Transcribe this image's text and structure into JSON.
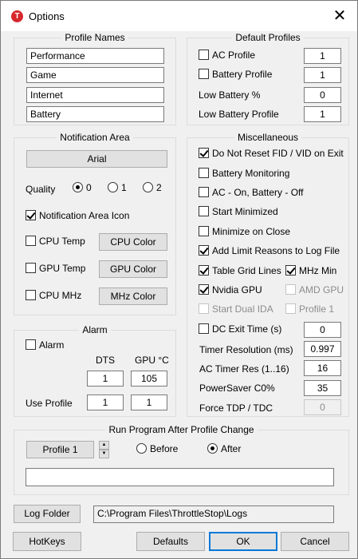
{
  "window": {
    "title": "Options",
    "icon_letter": "T",
    "close_glyph": "✕"
  },
  "profile_names": {
    "title": "Profile Names",
    "names": [
      "Performance",
      "Game",
      "Internet",
      "Battery"
    ]
  },
  "default_profiles": {
    "title": "Default Profiles",
    "rows": [
      {
        "label": "AC Profile",
        "value": "1",
        "checkbox": true,
        "checked": false
      },
      {
        "label": "Battery Profile",
        "value": "1",
        "checkbox": true,
        "checked": false
      },
      {
        "label": "Low Battery %",
        "value": "0",
        "checkbox": false
      },
      {
        "label": "Low Battery Profile",
        "value": "1",
        "checkbox": false
      }
    ]
  },
  "notification_area": {
    "title": "Notification Area",
    "font_button": "Arial",
    "quality_label": "Quality",
    "quality_options": [
      "0",
      "1",
      "2"
    ],
    "quality_selected": "0",
    "icon_label": "Notification Area Icon",
    "icon_checked": true,
    "items": [
      {
        "label": "CPU Temp",
        "checked": false,
        "button": "CPU Color"
      },
      {
        "label": "GPU Temp",
        "checked": false,
        "button": "GPU Color"
      },
      {
        "label": "CPU MHz",
        "checked": false,
        "button": "MHz Color"
      }
    ]
  },
  "miscellaneous": {
    "title": "Miscellaneous",
    "checks": [
      {
        "label": "Do Not Reset FID / VID on Exit",
        "checked": true
      },
      {
        "label": "Battery Monitoring",
        "checked": false
      },
      {
        "label": "AC - On, Battery - Off",
        "checked": false
      },
      {
        "label": "Start Minimized",
        "checked": false
      },
      {
        "label": "Minimize on Close",
        "checked": false
      },
      {
        "label": "Add Limit Reasons to Log File",
        "checked": true
      }
    ],
    "table_grid_lines": {
      "label": "Table Grid Lines",
      "checked": true
    },
    "mhz_min": {
      "label": "MHz Min",
      "checked": true
    },
    "nvidia_gpu": {
      "label": "Nvidia GPU",
      "checked": true
    },
    "amd_gpu": {
      "label": "AMD GPU",
      "checked": false
    },
    "start_dual_ida": {
      "label": "Start Dual IDA",
      "checked": false
    },
    "profile1": {
      "label": "Profile 1",
      "checked": false
    },
    "dc_exit_time": {
      "label": "DC Exit Time (s)",
      "checked": false,
      "value": "0"
    },
    "timer_resolution": {
      "label": "Timer Resolution (ms)",
      "value": "0.997"
    },
    "ac_timer_res": {
      "label": "AC Timer Res (1..16)",
      "value": "16"
    },
    "powersaver": {
      "label": "PowerSaver C0%",
      "value": "35"
    },
    "force_tdp": {
      "label": "Force TDP / TDC",
      "value": "0"
    }
  },
  "alarm": {
    "title": "Alarm",
    "alarm_label": "Alarm",
    "alarm_checked": false,
    "col_dts": "DTS",
    "col_gpu": "GPU °C",
    "dts_value": "1",
    "gpu_value": "105",
    "use_profile_label": "Use Profile",
    "use_profile_dts": "1",
    "use_profile_gpu": "1"
  },
  "run_program": {
    "title": "Run Program After Profile Change",
    "profile_button": "Profile 1",
    "before_label": "Before",
    "after_label": "After",
    "selected": "After",
    "program_path": ""
  },
  "log_folder": {
    "button": "Log Folder",
    "path": "C:\\Program Files\\ThrottleStop\\Logs"
  },
  "bottom_buttons": {
    "hotkeys": "HotKeys",
    "defaults": "Defaults",
    "ok": "OK",
    "cancel": "Cancel"
  },
  "colors": {
    "accent": "#0078d7",
    "app_icon": "#d7262d",
    "window_bg": "#f0f0f0"
  }
}
